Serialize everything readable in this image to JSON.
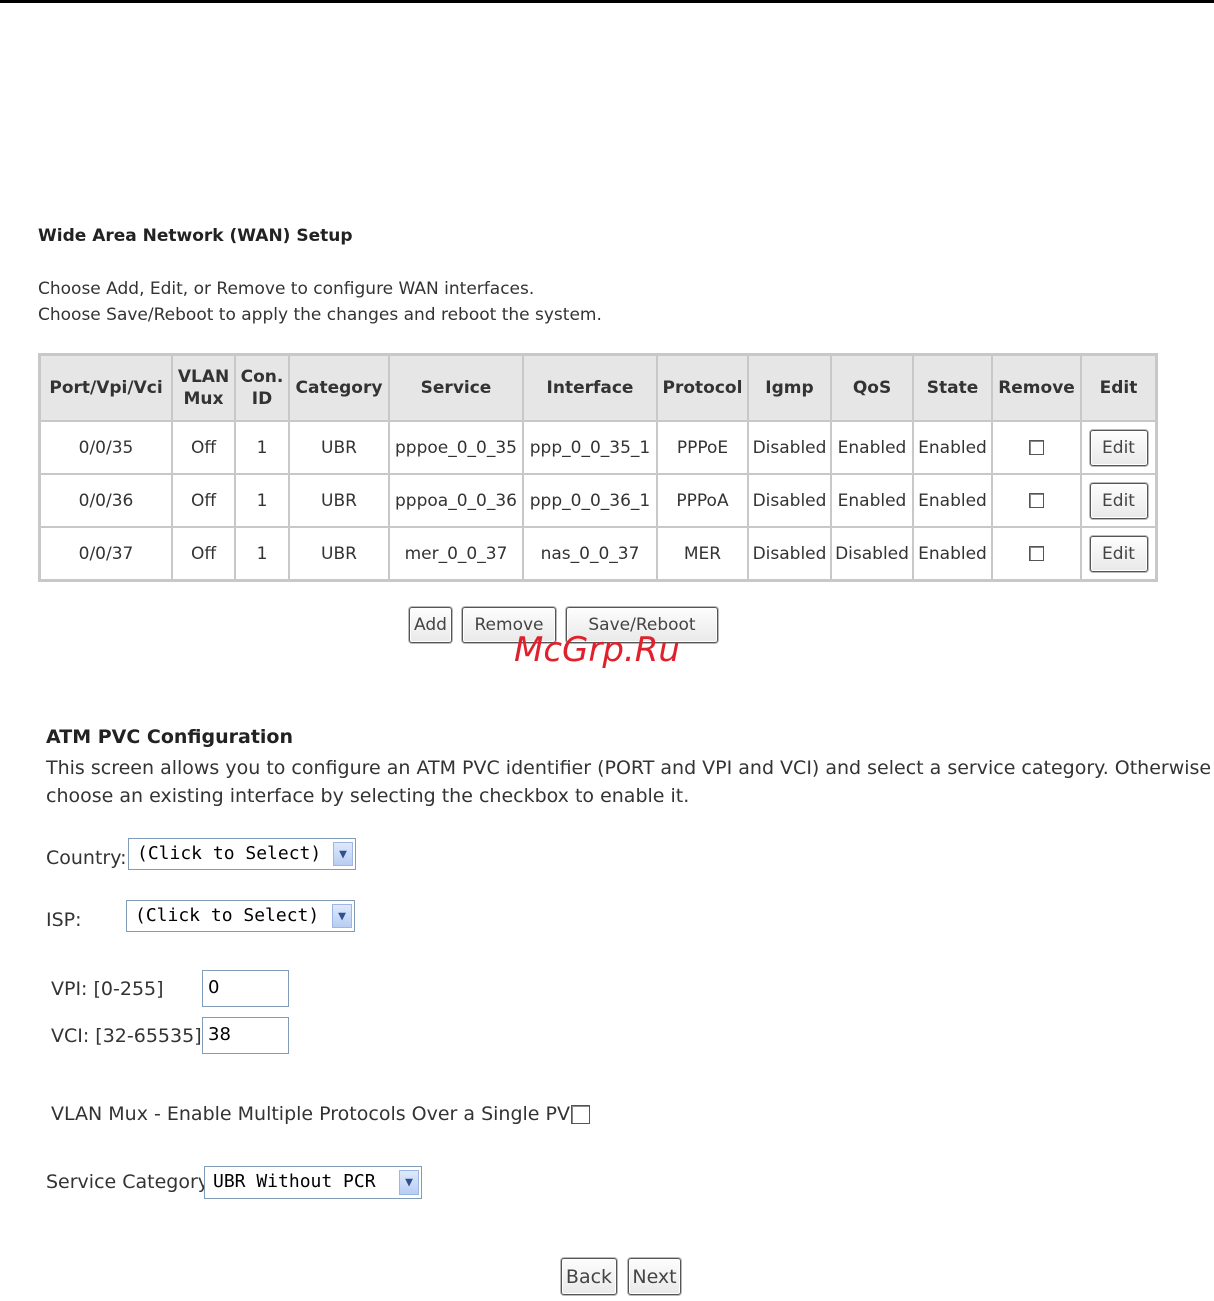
{
  "wan": {
    "title": "Wide Area Network (WAN) Setup",
    "desc_line1": "Choose Add, Edit, or Remove to configure WAN interfaces.",
    "desc_line2": "Choose Save/Reboot to apply the changes and reboot the system.",
    "headers": {
      "port": "Port/Vpi/Vci",
      "vlan_mux_1": "VLAN",
      "vlan_mux_2": "Mux",
      "con_id_1": "Con.",
      "con_id_2": "ID",
      "category": "Category",
      "service": "Service",
      "interface": "Interface",
      "protocol": "Protocol",
      "igmp": "Igmp",
      "qos": "QoS",
      "state": "State",
      "remove": "Remove",
      "edit": "Edit"
    },
    "rows": [
      {
        "port": "0/0/35",
        "vlan_mux": "Off",
        "con_id": "1",
        "category": "UBR",
        "service": "pppoe_0_0_35",
        "interface": "ppp_0_0_35_1",
        "protocol": "PPPoE",
        "igmp": "Disabled",
        "qos": "Enabled",
        "state": "Enabled",
        "edit": "Edit"
      },
      {
        "port": "0/0/36",
        "vlan_mux": "Off",
        "con_id": "1",
        "category": "UBR",
        "service": "pppoa_0_0_36",
        "interface": "ppp_0_0_36_1",
        "protocol": "PPPoA",
        "igmp": "Disabled",
        "qos": "Enabled",
        "state": "Enabled",
        "edit": "Edit"
      },
      {
        "port": "0/0/37",
        "vlan_mux": "Off",
        "con_id": "1",
        "category": "UBR",
        "service": "mer_0_0_37",
        "interface": "nas_0_0_37",
        "protocol": "MER",
        "igmp": "Disabled",
        "qos": "Disabled",
        "state": "Enabled",
        "edit": "Edit"
      }
    ],
    "buttons": {
      "add": "Add",
      "remove": "Remove",
      "save_reboot": "Save/Reboot"
    }
  },
  "watermark": "McGrp.Ru",
  "atm": {
    "title": "ATM PVC Configuration",
    "desc_line1": "This screen allows you to configure an ATM PVC identifier (PORT and VPI and VCI) and select a service category. Otherwise",
    "desc_line2": "choose an existing interface by selecting the checkbox to enable it.",
    "country_label": "Country:",
    "country_value": "(Click to Select)",
    "isp_label": "ISP:",
    "isp_value": "(Click to Select)",
    "vpi_label": "VPI: [0-255]",
    "vpi_value": "0",
    "vci_label": "VCI: [32-65535]",
    "vci_value": "38",
    "vlan_mux_label": "VLAN Mux - Enable Multiple Protocols Over a Single PVC",
    "service_category_label": "Service Category:",
    "service_category_value": "UBR Without PCR",
    "back": "Back",
    "next": "Next"
  }
}
